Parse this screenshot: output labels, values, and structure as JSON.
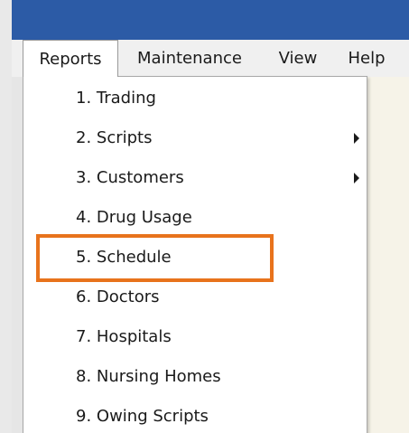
{
  "menubar": {
    "items": [
      {
        "label": "Reports"
      },
      {
        "label": "Maintenance"
      },
      {
        "label": "View"
      },
      {
        "label": "Help"
      }
    ]
  },
  "reports_menu": {
    "items": [
      {
        "label": "1. Trading",
        "has_submenu": false
      },
      {
        "label": "2. Scripts",
        "has_submenu": true
      },
      {
        "label": "3. Customers",
        "has_submenu": true
      },
      {
        "label": "4. Drug Usage",
        "has_submenu": false
      },
      {
        "label": "5. Schedule",
        "has_submenu": false,
        "highlighted": true
      },
      {
        "label": "6. Doctors",
        "has_submenu": false
      },
      {
        "label": "7. Hospitals",
        "has_submenu": false
      },
      {
        "label": "8. Nursing Homes",
        "has_submenu": false
      },
      {
        "label": "9. Owing Scripts",
        "has_submenu": false
      }
    ]
  },
  "colors": {
    "titlebar": "#2c5ba6",
    "highlight_outline": "#e8731c"
  },
  "icons": {
    "submenu_arrow": "submenu-arrow-icon"
  }
}
